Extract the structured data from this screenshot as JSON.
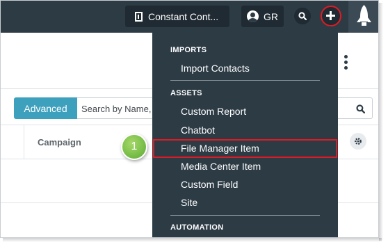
{
  "topbar": {
    "org_label": "Constant Cont...",
    "user_initials": "GR"
  },
  "toolbar": {
    "advanced_label": "Advanced",
    "search_placeholder": "Search by Name,"
  },
  "table": {
    "columns": [
      "Campaign"
    ]
  },
  "menu": {
    "sections": [
      {
        "heading": "IMPORTS",
        "items": [
          "Import Contacts"
        ]
      },
      {
        "heading": "ASSETS",
        "items": [
          "Custom Report",
          "Chatbot",
          "File Manager Item",
          "Media Center Item",
          "Custom Field",
          "Site"
        ]
      },
      {
        "heading": "AUTOMATION",
        "items": []
      }
    ]
  },
  "callout": {
    "step_number": "1"
  },
  "colors": {
    "topbar": "#2d3b45",
    "accent": "#3da0bd",
    "highlight": "#e01b24",
    "callout": "#7cc04b"
  }
}
